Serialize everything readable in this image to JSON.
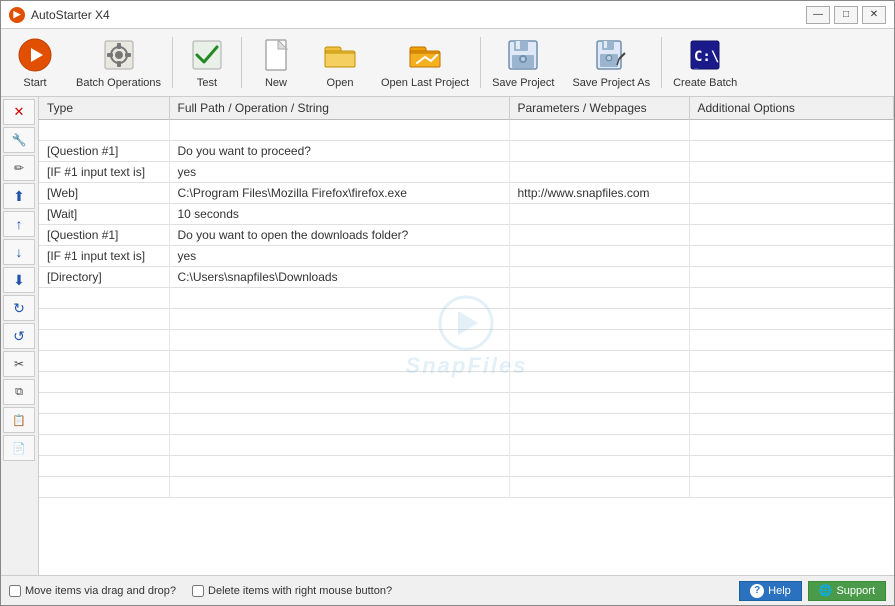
{
  "titlebar": {
    "title": "AutoStarter X4",
    "icon": "▶",
    "controls": {
      "minimize": "—",
      "maximize": "□",
      "close": "✕"
    }
  },
  "toolbar": {
    "buttons": [
      {
        "id": "start",
        "label": "Start",
        "icon": "play"
      },
      {
        "id": "batch-operations",
        "label": "Batch Operations",
        "icon": "batch"
      },
      {
        "id": "test",
        "label": "Test",
        "icon": "check"
      },
      {
        "id": "new",
        "label": "New",
        "icon": "new-doc"
      },
      {
        "id": "open",
        "label": "Open",
        "icon": "open-folder"
      },
      {
        "id": "open-last",
        "label": "Open Last Project",
        "icon": "open-last"
      },
      {
        "id": "save",
        "label": "Save Project",
        "icon": "save"
      },
      {
        "id": "save-as",
        "label": "Save Project As",
        "icon": "save-as"
      },
      {
        "id": "create-batch",
        "label": "Create Batch",
        "icon": "batch-create"
      }
    ]
  },
  "table": {
    "headers": [
      "Type",
      "Full Path / Operation / String",
      "Parameters / Webpages",
      "Additional Options"
    ],
    "rows": [
      {
        "type": "",
        "full": "",
        "params": "",
        "options": ""
      },
      {
        "type": "[Question #1]",
        "full": "Do you want to proceed?",
        "params": "",
        "options": ""
      },
      {
        "type": "[IF #1 input text is]",
        "full": "yes",
        "params": "",
        "options": ""
      },
      {
        "type": "[Web]",
        "full": "C:\\Program Files\\Mozilla Firefox\\firefox.exe",
        "params": "http://www.snapfiles.com",
        "options": ""
      },
      {
        "type": "[Wait]",
        "full": "10 seconds",
        "params": "",
        "options": ""
      },
      {
        "type": "[Question #1]",
        "full": "Do you want to open the downloads folder?",
        "params": "",
        "options": ""
      },
      {
        "type": "[IF #1 input text is]",
        "full": "yes",
        "params": "",
        "options": ""
      },
      {
        "type": "[Directory]",
        "full": "C:\\Users\\snapfiles\\Downloads",
        "params": "",
        "options": ""
      },
      {
        "type": "",
        "full": "",
        "params": "",
        "options": ""
      },
      {
        "type": "",
        "full": "",
        "params": "",
        "options": ""
      },
      {
        "type": "",
        "full": "",
        "params": "",
        "options": ""
      },
      {
        "type": "",
        "full": "",
        "params": "",
        "options": ""
      },
      {
        "type": "",
        "full": "",
        "params": "",
        "options": ""
      },
      {
        "type": "",
        "full": "",
        "params": "",
        "options": ""
      },
      {
        "type": "",
        "full": "",
        "params": "",
        "options": ""
      },
      {
        "type": "",
        "full": "",
        "params": "",
        "options": ""
      },
      {
        "type": "",
        "full": "",
        "params": "",
        "options": ""
      },
      {
        "type": "",
        "full": "",
        "params": "",
        "options": ""
      }
    ]
  },
  "sidebar_buttons": [
    {
      "id": "delete",
      "icon": "✕",
      "cls": "delete",
      "title": "Delete"
    },
    {
      "id": "edit",
      "icon": "✏",
      "cls": "",
      "title": "Edit"
    },
    {
      "id": "pencil",
      "icon": "✒",
      "cls": "",
      "title": "Edit item"
    },
    {
      "id": "move-up-fast",
      "icon": "⬆",
      "cls": "",
      "title": "Move to top"
    },
    {
      "id": "move-up",
      "icon": "↑",
      "cls": "",
      "title": "Move up"
    },
    {
      "id": "move-down",
      "icon": "↓",
      "cls": "",
      "title": "Move down"
    },
    {
      "id": "move-down-fast",
      "icon": "⬇",
      "cls": "",
      "title": "Move to bottom"
    },
    {
      "id": "rotate-up",
      "icon": "↻",
      "cls": "",
      "title": "Rotate up"
    },
    {
      "id": "rotate-down",
      "icon": "↺",
      "cls": "",
      "title": "Rotate down"
    },
    {
      "id": "cut",
      "icon": "✂",
      "cls": "",
      "title": "Cut"
    },
    {
      "id": "copy",
      "icon": "⧉",
      "cls": "",
      "title": "Copy"
    },
    {
      "id": "paste",
      "icon": "📋",
      "cls": "",
      "title": "Paste"
    },
    {
      "id": "paste2",
      "icon": "📄",
      "cls": "",
      "title": "Paste below"
    }
  ],
  "statusbar": {
    "drag_drop_label": "Move items via drag and drop?",
    "delete_label": "Delete items with right mouse button?",
    "help_label": "Help",
    "support_label": "Support"
  },
  "watermark": {
    "text": "SnapFiles"
  }
}
